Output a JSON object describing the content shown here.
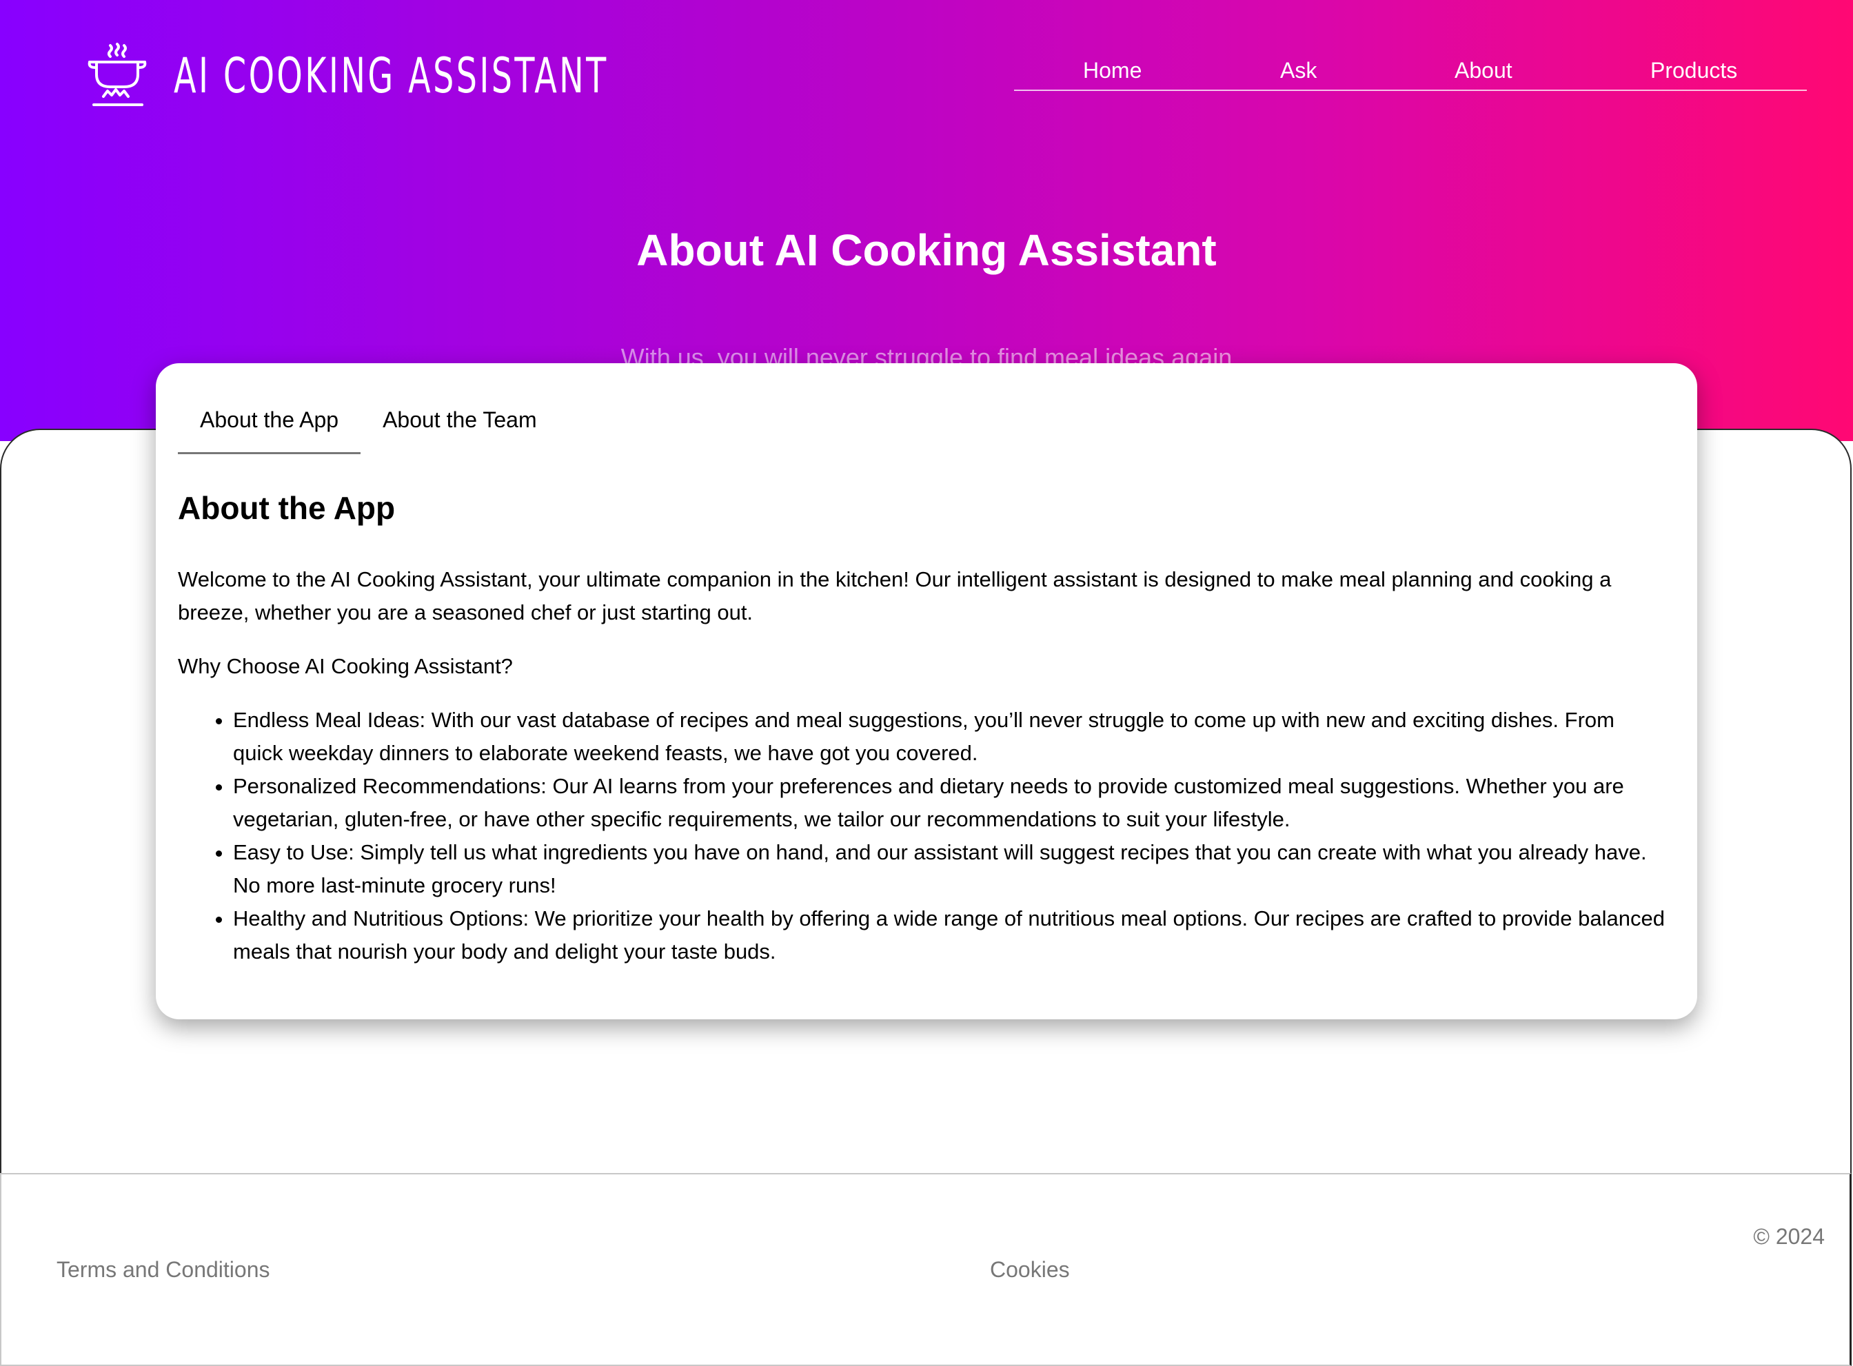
{
  "header": {
    "logo_text": "AI COOKING ASSISTANT",
    "logo_icon": "cooking-pot-icon",
    "nav": [
      {
        "label": "Home"
      },
      {
        "label": "Ask"
      },
      {
        "label": "About"
      },
      {
        "label": "Products"
      }
    ]
  },
  "hero": {
    "title": "About AI Cooking Assistant",
    "subtitle": "With us, you will never struggle to find meal ideas again"
  },
  "tabs": [
    {
      "label": "About the App",
      "active": true
    },
    {
      "label": "About the Team",
      "active": false
    }
  ],
  "content": {
    "heading": "About the App",
    "intro": "Welcome to the AI Cooking Assistant, your ultimate companion in the kitchen! Our intelligent assistant is designed to make meal planning and cooking a breeze, whether you are a seasoned chef or just starting out.",
    "why": "Why Choose AI Cooking Assistant?",
    "features": [
      "Endless Meal Ideas: With our vast database of recipes and meal suggestions, you’ll never struggle to come up with new and exciting dishes. From quick weekday dinners to elaborate weekend feasts, we have got you covered.",
      "Personalized Recommendations: Our AI learns from your preferences and dietary needs to provide customized meal suggestions. Whether you are vegetarian, gluten-free, or have other specific requirements, we tailor our recommendations to suit your lifestyle.",
      "Easy to Use: Simply tell us what ingredients you have on hand, and our assistant will suggest recipes that you can create with what you already have. No more last-minute grocery runs!",
      "Healthy and Nutritious Options: We prioritize your health by offering a wide range of nutritious meal options. Our recipes are crafted to provide balanced meals that nourish your body and delight your taste buds."
    ]
  },
  "footer": {
    "terms": "Terms and Conditions",
    "cookies": "Cookies",
    "copyright": "© 2024"
  },
  "colors": {
    "gradient_start": "#8800ff",
    "gradient_end": "#ff0873"
  }
}
